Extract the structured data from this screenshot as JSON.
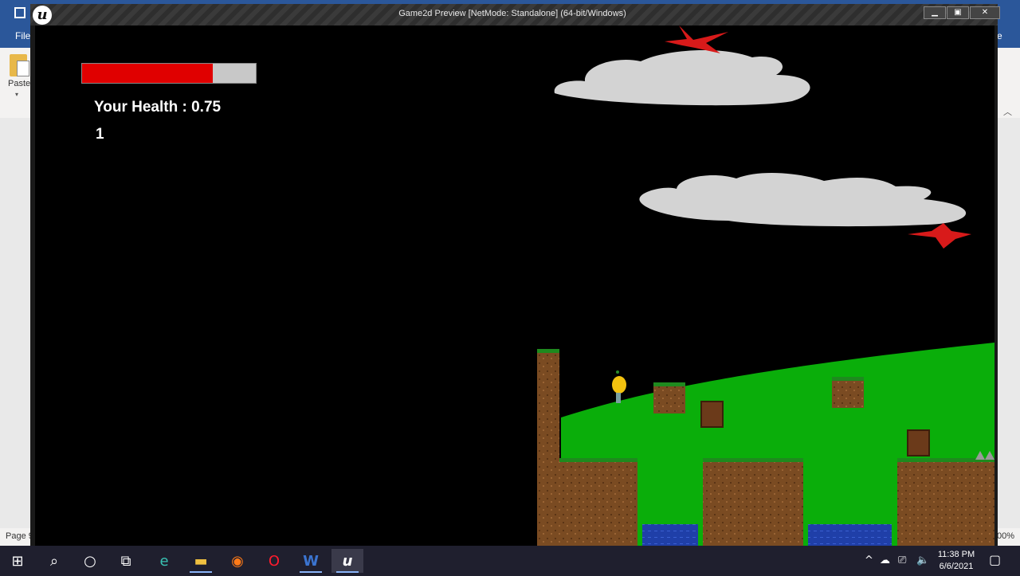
{
  "word": {
    "file_tab": "File",
    "truncated_tab": "e",
    "paste_label": "Paste",
    "status_page": "Page 9",
    "status_zoom": "00%"
  },
  "game_window": {
    "title": "Game2d Preview [NetMode: Standalone] (64-bit/Windows)",
    "logo_text": "u",
    "min_glyph": "▁",
    "max_glyph": "▣",
    "close_glyph": "✕"
  },
  "hud": {
    "health_text": "Your Health :  0.75",
    "health_fraction": 0.75,
    "health_color": "#e00000",
    "health_empty_color": "#c8c8c8",
    "score": "1"
  },
  "scene": {
    "sky_color": "#000000",
    "grass_color": "#0aae0a",
    "dirt_color": "#7a4b22",
    "water_color": "#1f3fa8",
    "star_color": "#d81a1a",
    "cloud_color": "#d3d3d3"
  },
  "taskbar": {
    "items": [
      {
        "name": "start-button",
        "icon": "windows-icon",
        "glyph": "⊞"
      },
      {
        "name": "search-button",
        "icon": "search-icon",
        "glyph": "⌕"
      },
      {
        "name": "cortana-button",
        "icon": "circle-icon",
        "glyph": "○"
      },
      {
        "name": "task-view-button",
        "icon": "task-view-icon",
        "glyph": "⧉"
      },
      {
        "name": "edge-button",
        "icon": "edge-icon",
        "glyph": "e"
      },
      {
        "name": "file-explorer-button",
        "icon": "folder-icon",
        "glyph": "▬"
      },
      {
        "name": "firefox-button",
        "icon": "firefox-icon",
        "glyph": "◉"
      },
      {
        "name": "opera-button",
        "icon": "opera-icon",
        "glyph": "O"
      },
      {
        "name": "word-button",
        "icon": "word-icon",
        "glyph": "W"
      },
      {
        "name": "unreal-button",
        "icon": "unreal-icon",
        "glyph": "u"
      }
    ],
    "time": "11:38 PM",
    "date": "6/6/2021",
    "tray_chevron": "^",
    "tray_cloud": "☁",
    "tray_network": "⎚",
    "tray_volume": "🔈",
    "notification_glyph": "▢"
  }
}
